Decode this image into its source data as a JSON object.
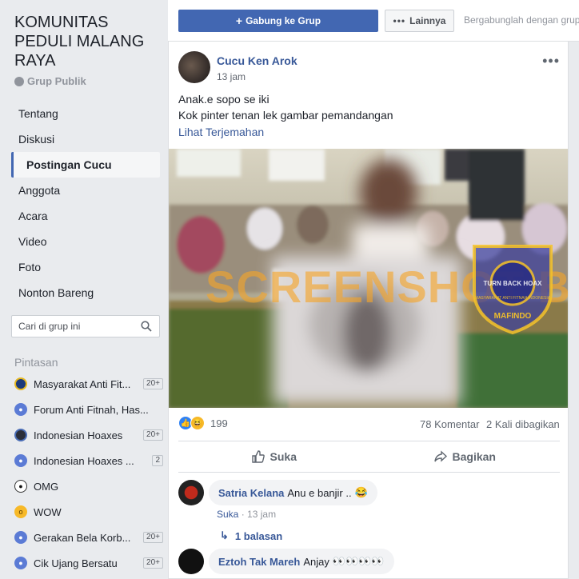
{
  "group": {
    "name": "KOMUNITAS PEDULI MALANG RAYA",
    "type": "Grup Publik"
  },
  "nav": {
    "items": [
      {
        "label": "Tentang",
        "active": false
      },
      {
        "label": "Diskusi",
        "active": false
      },
      {
        "label": "Postingan Cucu",
        "active": true
      },
      {
        "label": "Anggota",
        "active": false
      },
      {
        "label": "Acara",
        "active": false
      },
      {
        "label": "Video",
        "active": false
      },
      {
        "label": "Foto",
        "active": false
      },
      {
        "label": "Nonton Bareng",
        "active": false
      }
    ]
  },
  "search": {
    "placeholder": "Cari di grup ini"
  },
  "shortcuts": {
    "title": "Pintasan",
    "items": [
      {
        "label": "Masyarakat Anti Fit...",
        "badge": "20+",
        "icon": "mafindo-logo-icon"
      },
      {
        "label": "Forum Anti Fitnah, Has...",
        "badge": "",
        "icon": "group-icon"
      },
      {
        "label": "Indonesian Hoaxes",
        "badge": "20+",
        "icon": "indonesian-hoaxes-logo-icon"
      },
      {
        "label": "Indonesian Hoaxes ...",
        "badge": "2",
        "icon": "group-icon"
      },
      {
        "label": "OMG",
        "badge": "",
        "icon": "soccer-ball-icon"
      },
      {
        "label": "WOW",
        "badge": "",
        "icon": "wow-emoji-icon"
      },
      {
        "label": "Gerakan Bela Korb...",
        "badge": "20+",
        "icon": "group-icon"
      },
      {
        "label": "Cik Ujang Bersatu",
        "badge": "20+",
        "icon": "group-icon"
      }
    ]
  },
  "topbar": {
    "join_label": "Gabung ke Grup",
    "more_label": "Lainnya",
    "hint": "Bergabunglah dengan grup"
  },
  "post": {
    "author": "Cucu Ken Arok",
    "time": "13 jam",
    "line1": "Anak.e sopo se iki",
    "line2": "Kok pinter tenan lek gambar pemandangan",
    "translate": "Lihat Terjemahan",
    "watermark": "SCREENSHOT BY",
    "seal_top": "MASYARAKAT ANTI FITNAH INDONESIA",
    "seal_center": "TURN BACK HOAX",
    "seal_bottom": "MAFINDO",
    "reaction_count": "199",
    "comment_count": "78 Komentar",
    "share_count": "2 Kali dibagikan",
    "like_label": "Suka",
    "share_label": "Bagikan"
  },
  "comments": [
    {
      "name": "Satria Kelana",
      "text": "Anu e banjir ..",
      "emoji": "😂",
      "like_label": "Suka",
      "time": "13 jam"
    },
    {
      "name": "Eztoh Tak Mareh",
      "text": "Anjay",
      "emoji": "👀👀👀👀",
      "like_label": "",
      "time": ""
    }
  ],
  "replies_label": "1 balasan",
  "colors": {
    "accent": "#4267b2",
    "link": "#385898",
    "watermark": "#f6a428",
    "seal": "#3a3f9c"
  }
}
